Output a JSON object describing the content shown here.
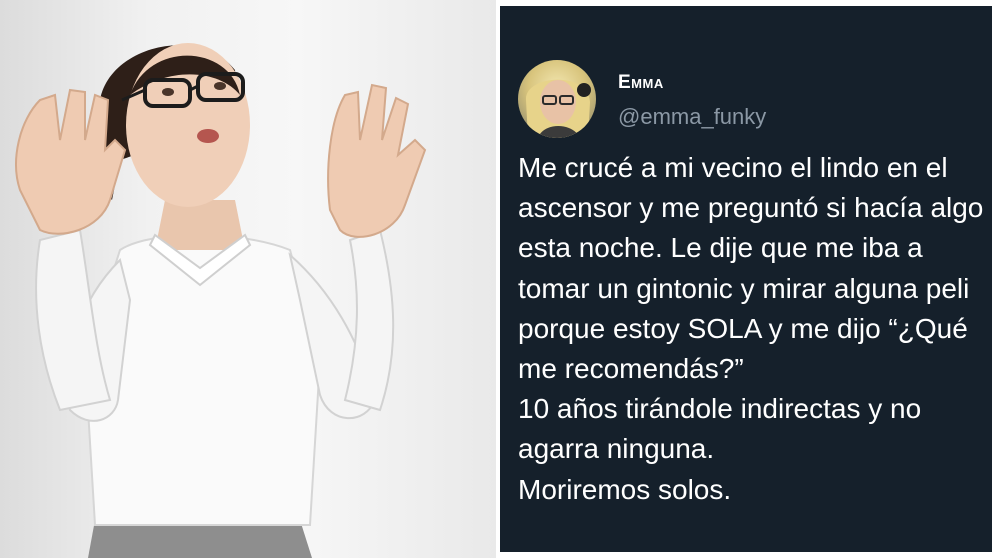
{
  "tweet": {
    "display_name": "Emma",
    "handle": "@emma_funky",
    "lines": [
      "Me crucé a mi vecino el lindo en el",
      "ascensor y me preguntó si hacía algo",
      "esta noche. Le dije que me iba a",
      "tomar un gintonic y mirar alguna peli",
      "porque estoy SOLA y me dijo “¿Qué",
      "me recomendás?”",
      "10 años tirándole indirectas y no",
      "agarra ninguna.",
      "Moriremos solos."
    ]
  },
  "colors": {
    "tweet_background": "#15202b",
    "tweet_text": "#ffffff",
    "handle_text": "#8b98a5"
  },
  "icons": {
    "photo": "woman-raising-hands-photo",
    "avatar": "avatar-photo"
  }
}
